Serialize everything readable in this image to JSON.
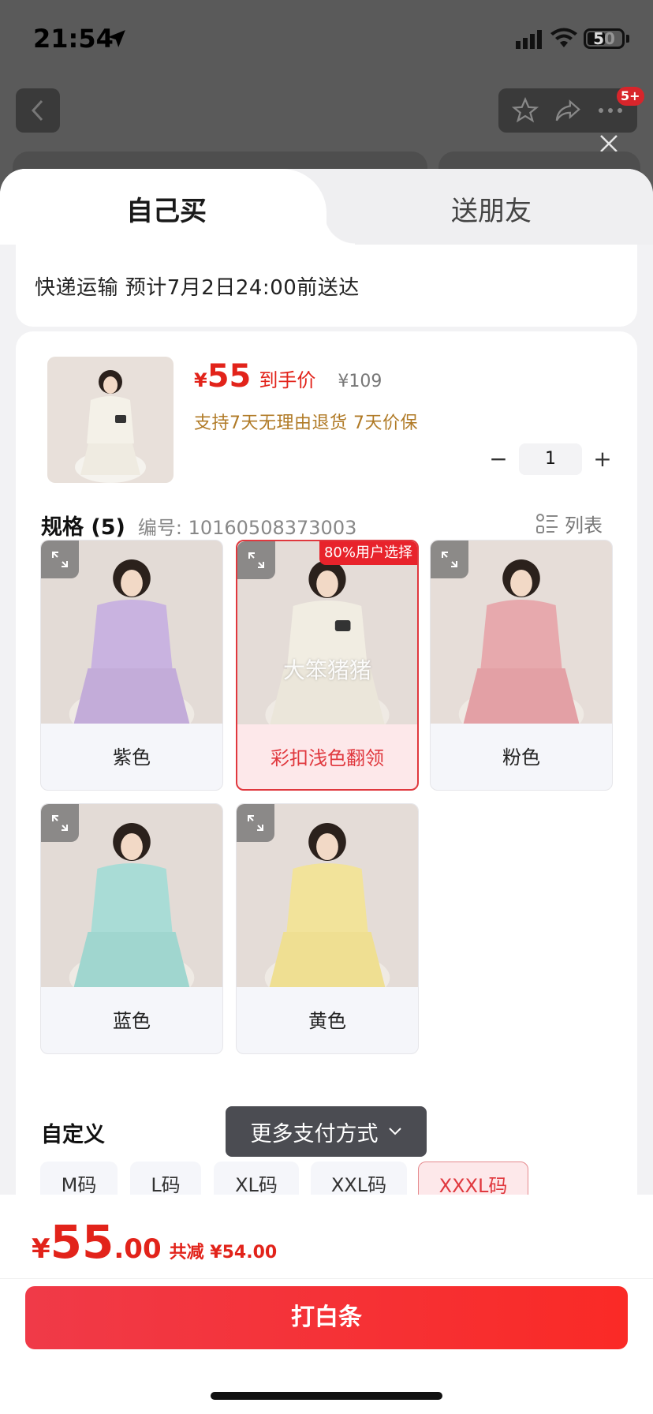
{
  "status_bar": {
    "time": "21:54",
    "battery": "50"
  },
  "top_bar": {
    "more_badge": "5+"
  },
  "tabs": [
    {
      "label": "自己买"
    },
    {
      "label": "送朋友"
    }
  ],
  "delivery": {
    "text": "快递运输 预计7月2日24:00前送达"
  },
  "product": {
    "price_symbol": "¥",
    "price": "55",
    "price_tag": "到手价",
    "original_price": "¥109",
    "service": "支持7天无理由退货   7天价保",
    "quantity": "1",
    "minus": "−",
    "plus": "+"
  },
  "spec": {
    "title": "规格 (5)",
    "code": "编号: 10160508373003",
    "list_toggle": "列表",
    "options": [
      {
        "label": "紫色",
        "color": "#c9b3e0"
      },
      {
        "label": "彩扣浅色翻领",
        "color": "#f1ede2",
        "badge": "80%用户选择",
        "watermark": "大笨猪猪",
        "selected": true
      },
      {
        "label": "粉色",
        "color": "#e7a9ad"
      },
      {
        "label": "蓝色",
        "color": "#a9dcd6"
      },
      {
        "label": "黄色",
        "color": "#f2e39a"
      }
    ]
  },
  "custom": {
    "title": "自定义",
    "sizes": [
      {
        "label": "M码"
      },
      {
        "label": "L码"
      },
      {
        "label": "XL码"
      },
      {
        "label": "XXL码"
      },
      {
        "label": "XXXL码",
        "selected": true
      }
    ]
  },
  "pay_toast": {
    "label": "更多支付方式"
  },
  "bottom": {
    "total_symbol": "¥",
    "total_int": "55",
    "total_dec": ".00",
    "savings": "共减 ¥54.00",
    "cta": "打白条"
  },
  "colors": {
    "accent": "#e2231a",
    "service": "#b07a26",
    "selected_border": "#e0383e"
  }
}
